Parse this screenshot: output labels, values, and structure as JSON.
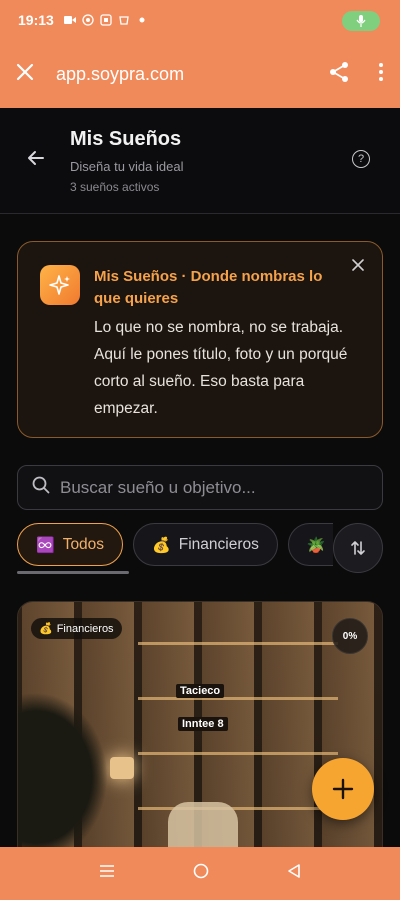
{
  "status_bar": {
    "time": "19:13",
    "icons": [
      "video-icon",
      "whatsapp-icon",
      "sim-icon",
      "shopping-icon",
      "dot-icon"
    ],
    "mic_active": true
  },
  "browser": {
    "url": "app.soypra.com"
  },
  "header": {
    "title": "Mis Sueños",
    "subtitle": "Diseña tu vida ideal",
    "count": "3 sueños activos"
  },
  "info_card": {
    "title": "Mis Sueños · Donde nombras lo que quieres",
    "body": "Lo que no se nombra, no se trabaja. Aquí le pones título, foto y un porqué corto al sueño. Eso basta para empezar."
  },
  "search": {
    "placeholder": "Buscar sueño u objetivo..."
  },
  "filters": [
    {
      "emoji": "♾️",
      "label": "Todos",
      "active": true
    },
    {
      "emoji": "💰",
      "label": "Financieros",
      "active": false
    },
    {
      "emoji": "🪴",
      "label": "",
      "active": false
    }
  ],
  "dream": {
    "category_emoji": "💰",
    "category": "Financieros",
    "progress": "0%",
    "signs": [
      "Tacieco",
      "Inntee 8"
    ]
  },
  "colors": {
    "accent": "#f08a5a",
    "highlight": "#f6a24a",
    "fab": "#f7a531"
  }
}
